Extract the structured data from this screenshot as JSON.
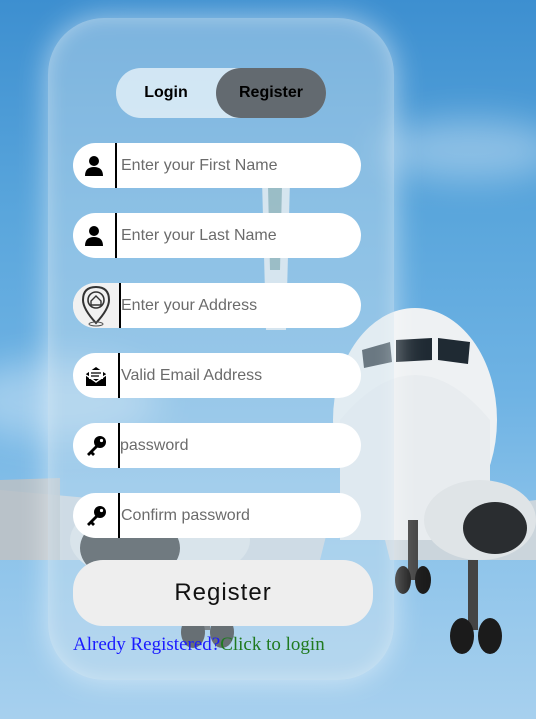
{
  "tabs": {
    "login": "Login",
    "register": "Register",
    "active": "register"
  },
  "fields": [
    {
      "icon": "user-icon",
      "placeholder": "Enter your First Name",
      "value": ""
    },
    {
      "icon": "user-icon",
      "placeholder": "Enter your Last Name",
      "value": ""
    },
    {
      "icon": "location-pin-icon",
      "placeholder": "Enter your Address",
      "value": ""
    },
    {
      "icon": "mail-icon",
      "placeholder": "Valid Email Address",
      "value": ""
    },
    {
      "icon": "key-icon",
      "placeholder": "password",
      "value": ""
    },
    {
      "icon": "key-icon",
      "placeholder": "Confirm password",
      "value": ""
    }
  ],
  "register_button": "Register",
  "footer": {
    "question": "Alredy Registered?",
    "link": "Click to login"
  },
  "colors": {
    "active_tab": "#636a70",
    "footer_question": "#1a1aff",
    "footer_link": "#1f7a1f"
  }
}
